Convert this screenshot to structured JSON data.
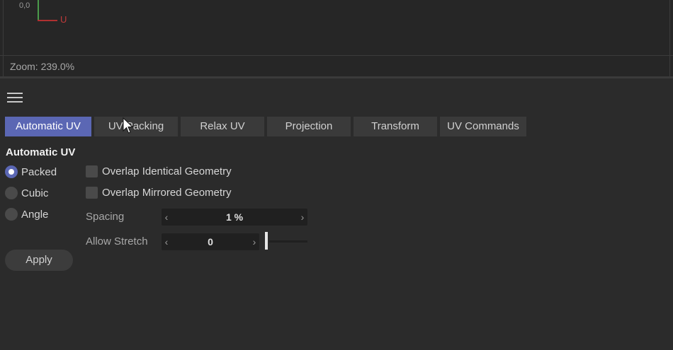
{
  "viewport": {
    "origin_label": "0,0",
    "u_axis_label": "U",
    "zoom_text": "Zoom: 239.0%",
    "colors": {
      "u_axis": "#b03030",
      "v_axis": "#4a9a4a"
    }
  },
  "panel": {
    "menu_icon": "hamburger-menu-icon",
    "tabs": [
      {
        "label": "Automatic UV",
        "active": true
      },
      {
        "label": "UV Packing",
        "active": false
      },
      {
        "label": "Relax UV",
        "active": false
      },
      {
        "label": "Projection",
        "active": false
      },
      {
        "label": "Transform",
        "active": false
      },
      {
        "label": "UV Commands",
        "active": false
      }
    ],
    "section_title": "Automatic UV",
    "modes": [
      {
        "label": "Packed",
        "selected": true
      },
      {
        "label": "Cubic",
        "selected": false
      },
      {
        "label": "Angle",
        "selected": false
      }
    ],
    "options": [
      {
        "label": "Overlap Identical Geometry",
        "checked": false
      },
      {
        "label": "Overlap Mirrored Geometry",
        "checked": false
      }
    ],
    "spacing": {
      "label": "Spacing",
      "value": "1 %"
    },
    "allow_stretch": {
      "label": "Allow Stretch",
      "value": "0",
      "slider_fraction": 0
    },
    "apply_label": "Apply",
    "accent_color": "#5b67b4"
  }
}
